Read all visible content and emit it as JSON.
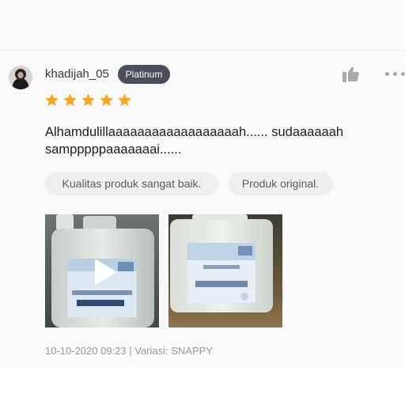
{
  "review": {
    "username": "khadijah_05",
    "badge": "Platinum",
    "rating": 5,
    "rating_max": 5,
    "text": "Alhamdulillaaaaaaaaaaaaaaaaaah...... sudaaaaaah sampppppaaaaaaai......",
    "tags": [
      "Kualitas produk sangat baik.",
      "Produk original."
    ],
    "media": [
      {
        "kind": "video",
        "icon": "play-icon"
      },
      {
        "kind": "photo"
      }
    ],
    "meta": "10-10-2020 09:23 | Variasi: SNAPPY"
  },
  "icons": {
    "like": "thumbs-up-icon",
    "more": "more-horizontal-icon",
    "star": "star-icon"
  },
  "colors": {
    "badge_bg": "#4b4f5c",
    "star": "#f5a623",
    "icon_grey": "#a9a9a9",
    "tag_bg": "#efefef",
    "meta_text": "#9a9a9a"
  }
}
